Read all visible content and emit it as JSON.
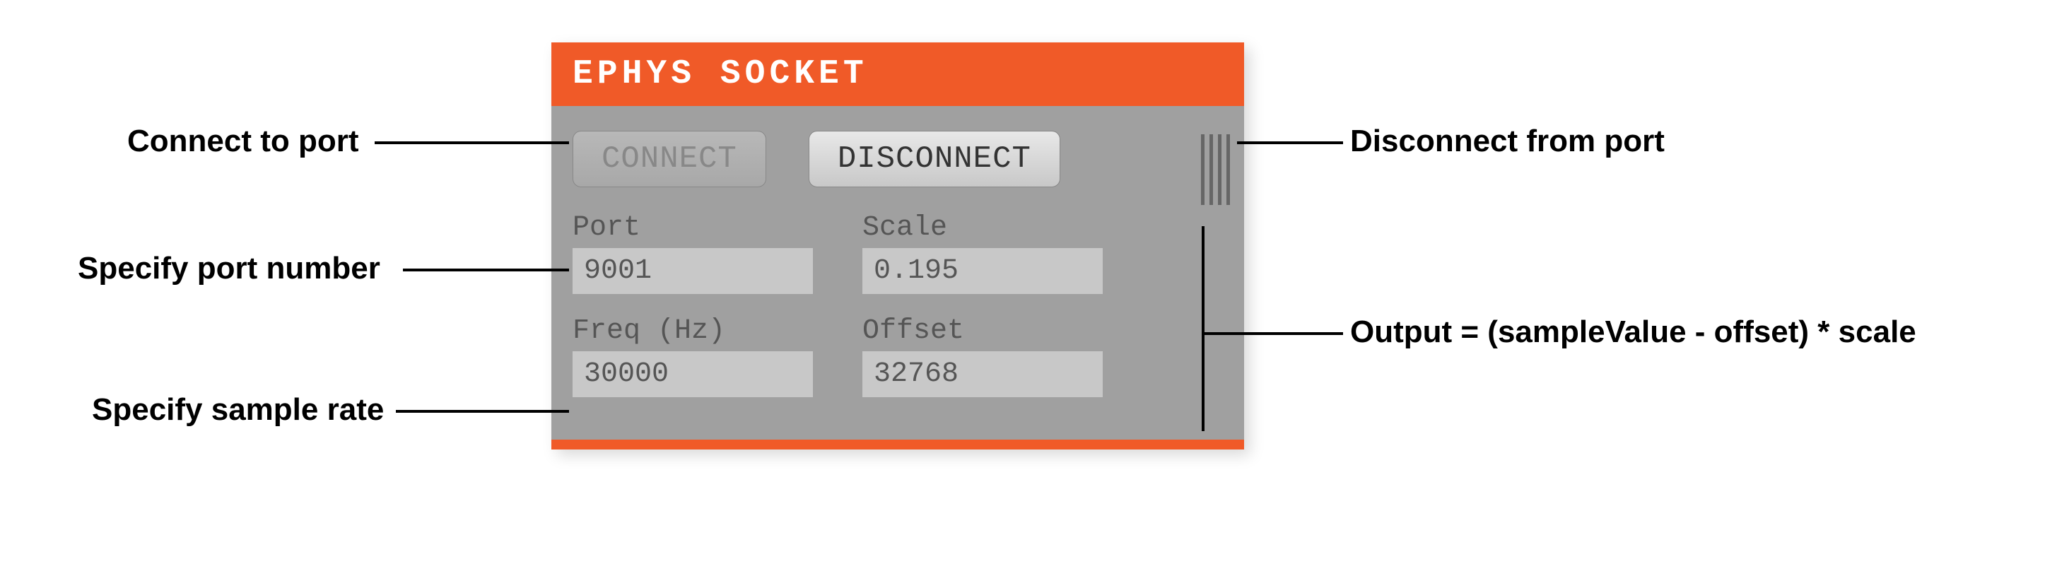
{
  "panel": {
    "title": "EPHYS SOCKET",
    "buttons": {
      "connect_label": "CONNECT",
      "disconnect_label": "DISCONNECT"
    },
    "fields": {
      "port": {
        "label": "Port",
        "value": "9001"
      },
      "scale": {
        "label": "Scale",
        "value": "0.195"
      },
      "freq": {
        "label": "Freq (Hz)",
        "value": "30000"
      },
      "offset": {
        "label": "Offset",
        "value": "32768"
      }
    }
  },
  "annotations": {
    "connect": "Connect to port",
    "disconnect": "Disconnect from port",
    "port_number": "Specify port number",
    "sample_rate": "Specify sample rate",
    "output_formula": "Output = (sampleValue - offset) * scale"
  }
}
